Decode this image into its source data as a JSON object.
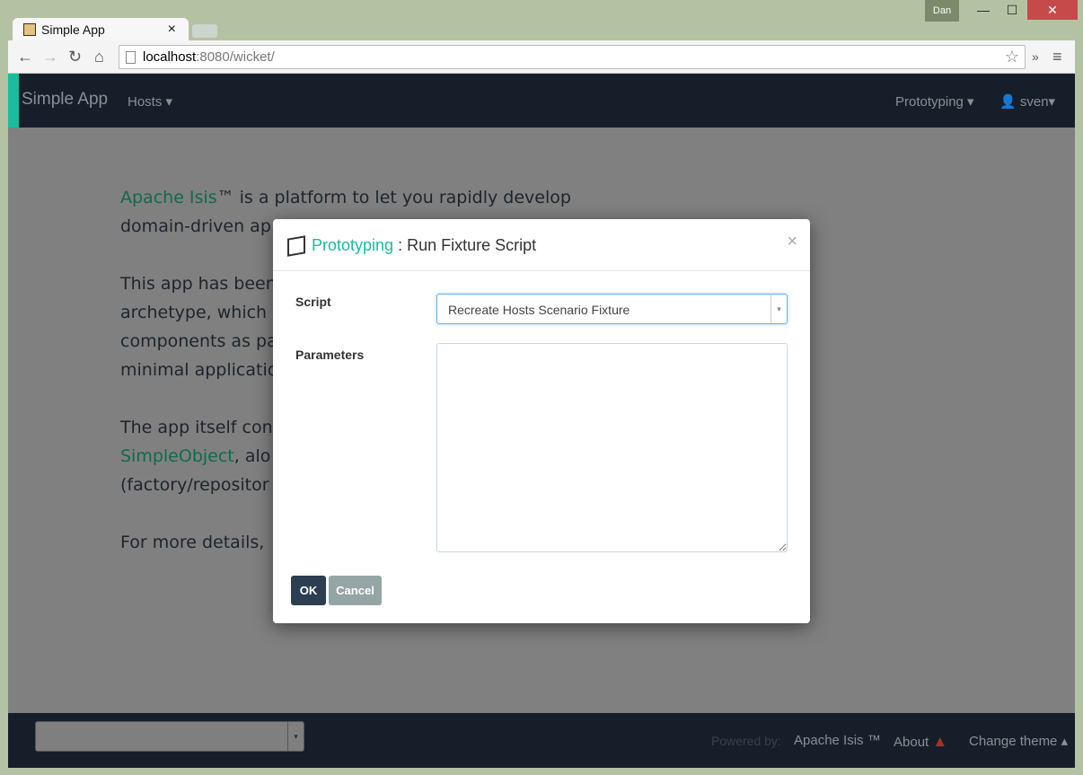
{
  "window": {
    "user": "Dan",
    "minimize": "—",
    "maximize": "☐",
    "close": "✕"
  },
  "tab": {
    "title": "Simple App",
    "close": "×"
  },
  "address": {
    "host": "localhost",
    "rest": ":8080/wicket/"
  },
  "navbar": {
    "brand": "Simple App",
    "hosts": "Hosts",
    "prototyping": "Prototyping",
    "user": "sven",
    "accent": "#1abc9c"
  },
  "content": {
    "p1": {
      "link": "Apache Isis",
      "text": "™ is a platform to let you rapidly develop",
      "line2": "domain-driven ap"
    },
    "p2": [
      "This app has been",
      "archetype, which",
      "components as pa",
      "minimal applicatio"
    ],
    "p3": {
      "line1": "The app itself con",
      "link": "SimpleObject",
      "after": ", alo",
      "line3": "(factory/repositor"
    },
    "p4": "For more details,"
  },
  "modal": {
    "icon": "cube-icon",
    "menu": "Prototyping",
    "title": " : Run Fixture Script",
    "close": "×",
    "script_label": "Script",
    "script_value": "Recreate Hosts Scenario Fixture",
    "params_label": "Parameters",
    "params_value": "",
    "ok": "OK",
    "cancel": "Cancel"
  },
  "footer": {
    "select_value": "",
    "powered": "Powered by:",
    "isis": "Apache Isis ™",
    "about": "About",
    "theme": "Change theme",
    "warning_color": "#a93226"
  }
}
